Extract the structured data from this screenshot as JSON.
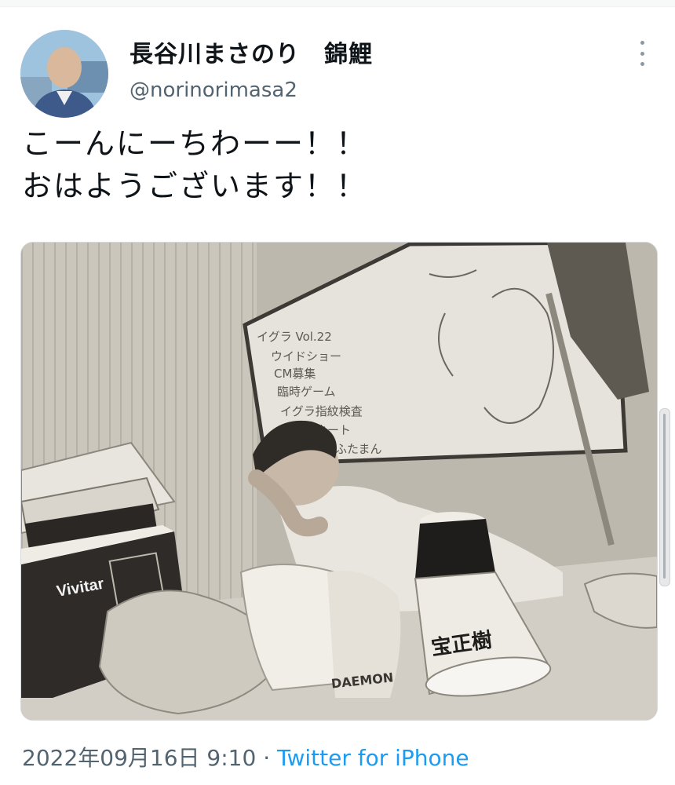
{
  "tweet": {
    "author": {
      "display_name": "長谷川まさのり　錦鯉",
      "handle": "@norinorimasa2"
    },
    "text_lines": [
      "こーんにーちわーー！！",
      "おはようございます！！"
    ],
    "date": "2022年09月16日 9:10",
    "separator": " · ",
    "source": "Twitter for iPhone",
    "more_icon": "more-vertical-icon"
  },
  "photo": {
    "whiteboard_lines": [
      "イグラ Vol.22",
      "ウイドショー",
      "CM募集",
      "臨時ゲーム",
      "イグラ指紋検査",
      "ネネート",
      "ふたまん"
    ],
    "box_brand": "Vivitar",
    "megaphone_text": "宝正樹",
    "cup_text": "DAEMON"
  },
  "colors": {
    "text": "#0f1419",
    "secondary": "#536471",
    "link": "#1d9bf0"
  }
}
